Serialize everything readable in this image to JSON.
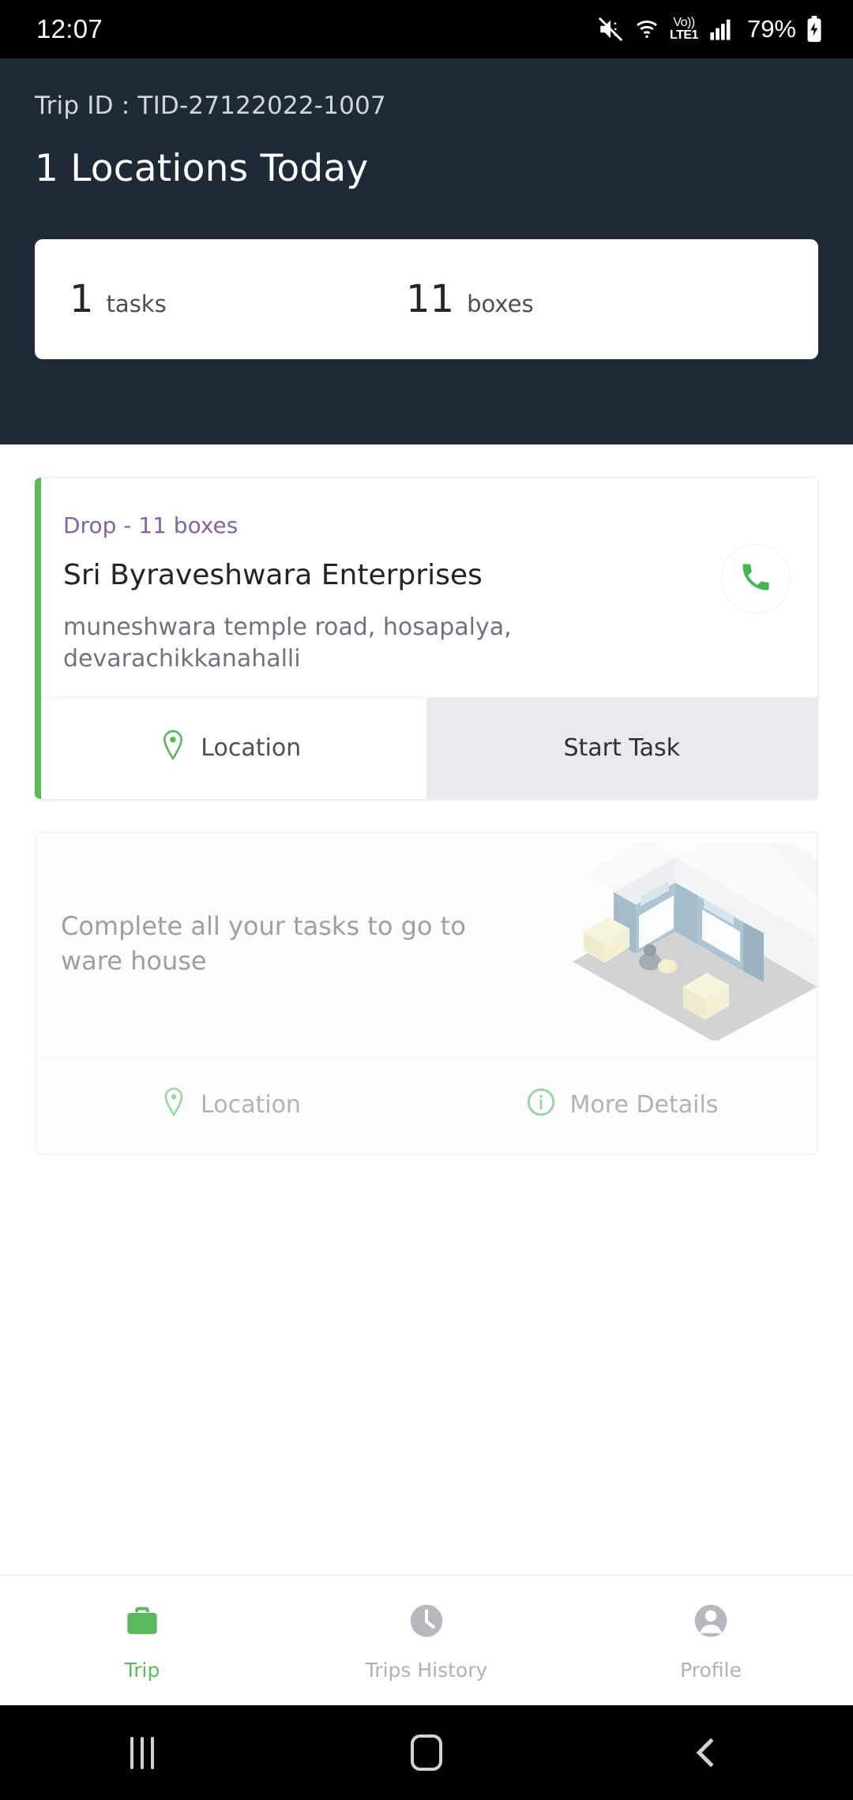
{
  "statusbar": {
    "time": "12:07",
    "battery_percent": "79%",
    "volte_top": "Vo))",
    "volte_bottom": "LTE1",
    "icons": [
      "mute-icon",
      "wifi-icon",
      "volte-icon",
      "signal-icon",
      "battery-charging-icon"
    ]
  },
  "header": {
    "trip_id": "Trip ID : TID-27122022-1007",
    "title": "1 Locations Today",
    "background_color": "#1e2a36",
    "stats": [
      {
        "value": "1",
        "label": "tasks"
      },
      {
        "value": "11",
        "label": "boxes"
      }
    ]
  },
  "task_card": {
    "accent_color": "#5cb85c",
    "drop_label": "Drop - 11 boxes",
    "drop_color": "#8364a8",
    "name": "Sri Byraveshwara Enterprises",
    "address": "muneshwara temple road, hosapalya, devarachikkanahalli",
    "call_icon": "phone-icon",
    "actions": {
      "location_label": "Location",
      "location_icon": "map-pin-icon",
      "start_label": "Start Task"
    }
  },
  "warehouse_card": {
    "message": "Complete all your tasks to go to ware house",
    "illustration": "warehouse-illustration",
    "actions": {
      "location_label": "Location",
      "location_icon": "map-pin-icon",
      "details_label": "More Details",
      "details_icon": "info-icon"
    }
  },
  "bottom_nav": {
    "active_color": "#5cb85c",
    "items": [
      {
        "label": "Trip",
        "icon": "briefcase-icon",
        "active": true
      },
      {
        "label": "Trips History",
        "icon": "clock-icon",
        "active": false
      },
      {
        "label": "Profile",
        "icon": "person-icon",
        "active": false
      }
    ]
  },
  "android_nav": {
    "recents": "recents-icon",
    "home": "home-icon",
    "back": "back-icon"
  }
}
